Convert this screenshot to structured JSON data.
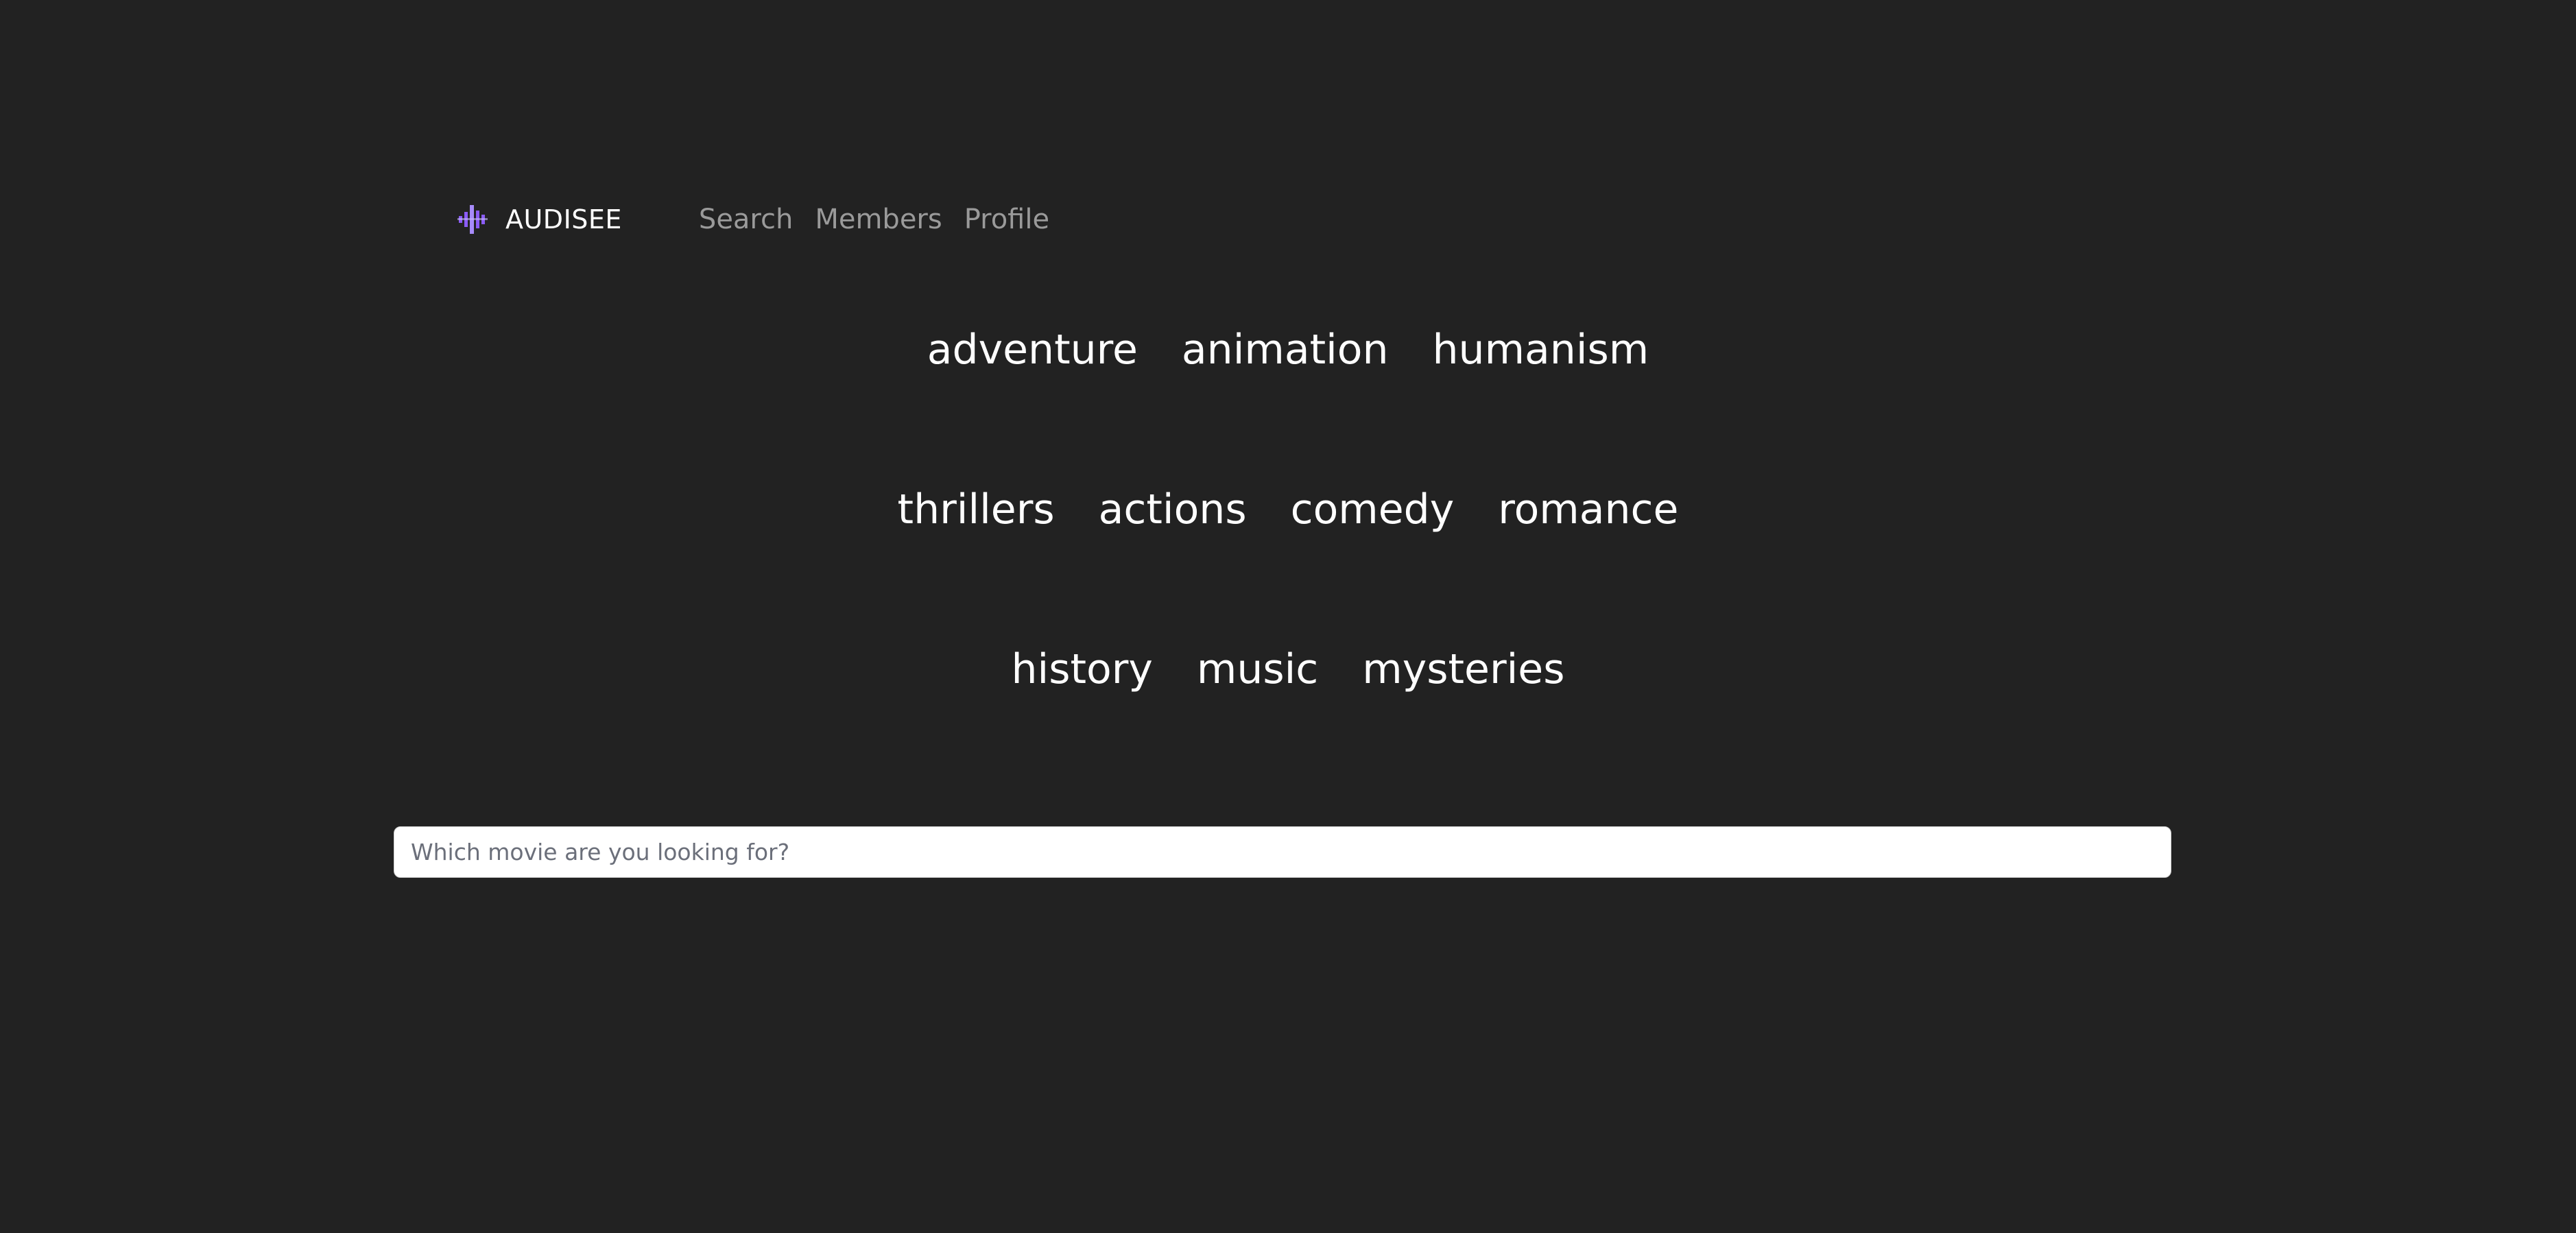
{
  "brand": {
    "name": "AUDISEE",
    "logo_icon": "equalizer-icon",
    "accent_color": "#8b5cf6"
  },
  "nav": {
    "links": [
      {
        "label": "Search"
      },
      {
        "label": "Members"
      },
      {
        "label": "Profile"
      }
    ]
  },
  "genres": {
    "rows": [
      [
        "adventure",
        "animation",
        "humanism"
      ],
      [
        "thrillers",
        "actions",
        "comedy",
        "romance"
      ],
      [
        "history",
        "music",
        "mysteries"
      ]
    ]
  },
  "search": {
    "placeholder": "Which movie are you looking for?",
    "value": ""
  },
  "colors": {
    "background": "#222222",
    "nav_text": "#9a9a9a",
    "genre_text": "#ffffff"
  }
}
